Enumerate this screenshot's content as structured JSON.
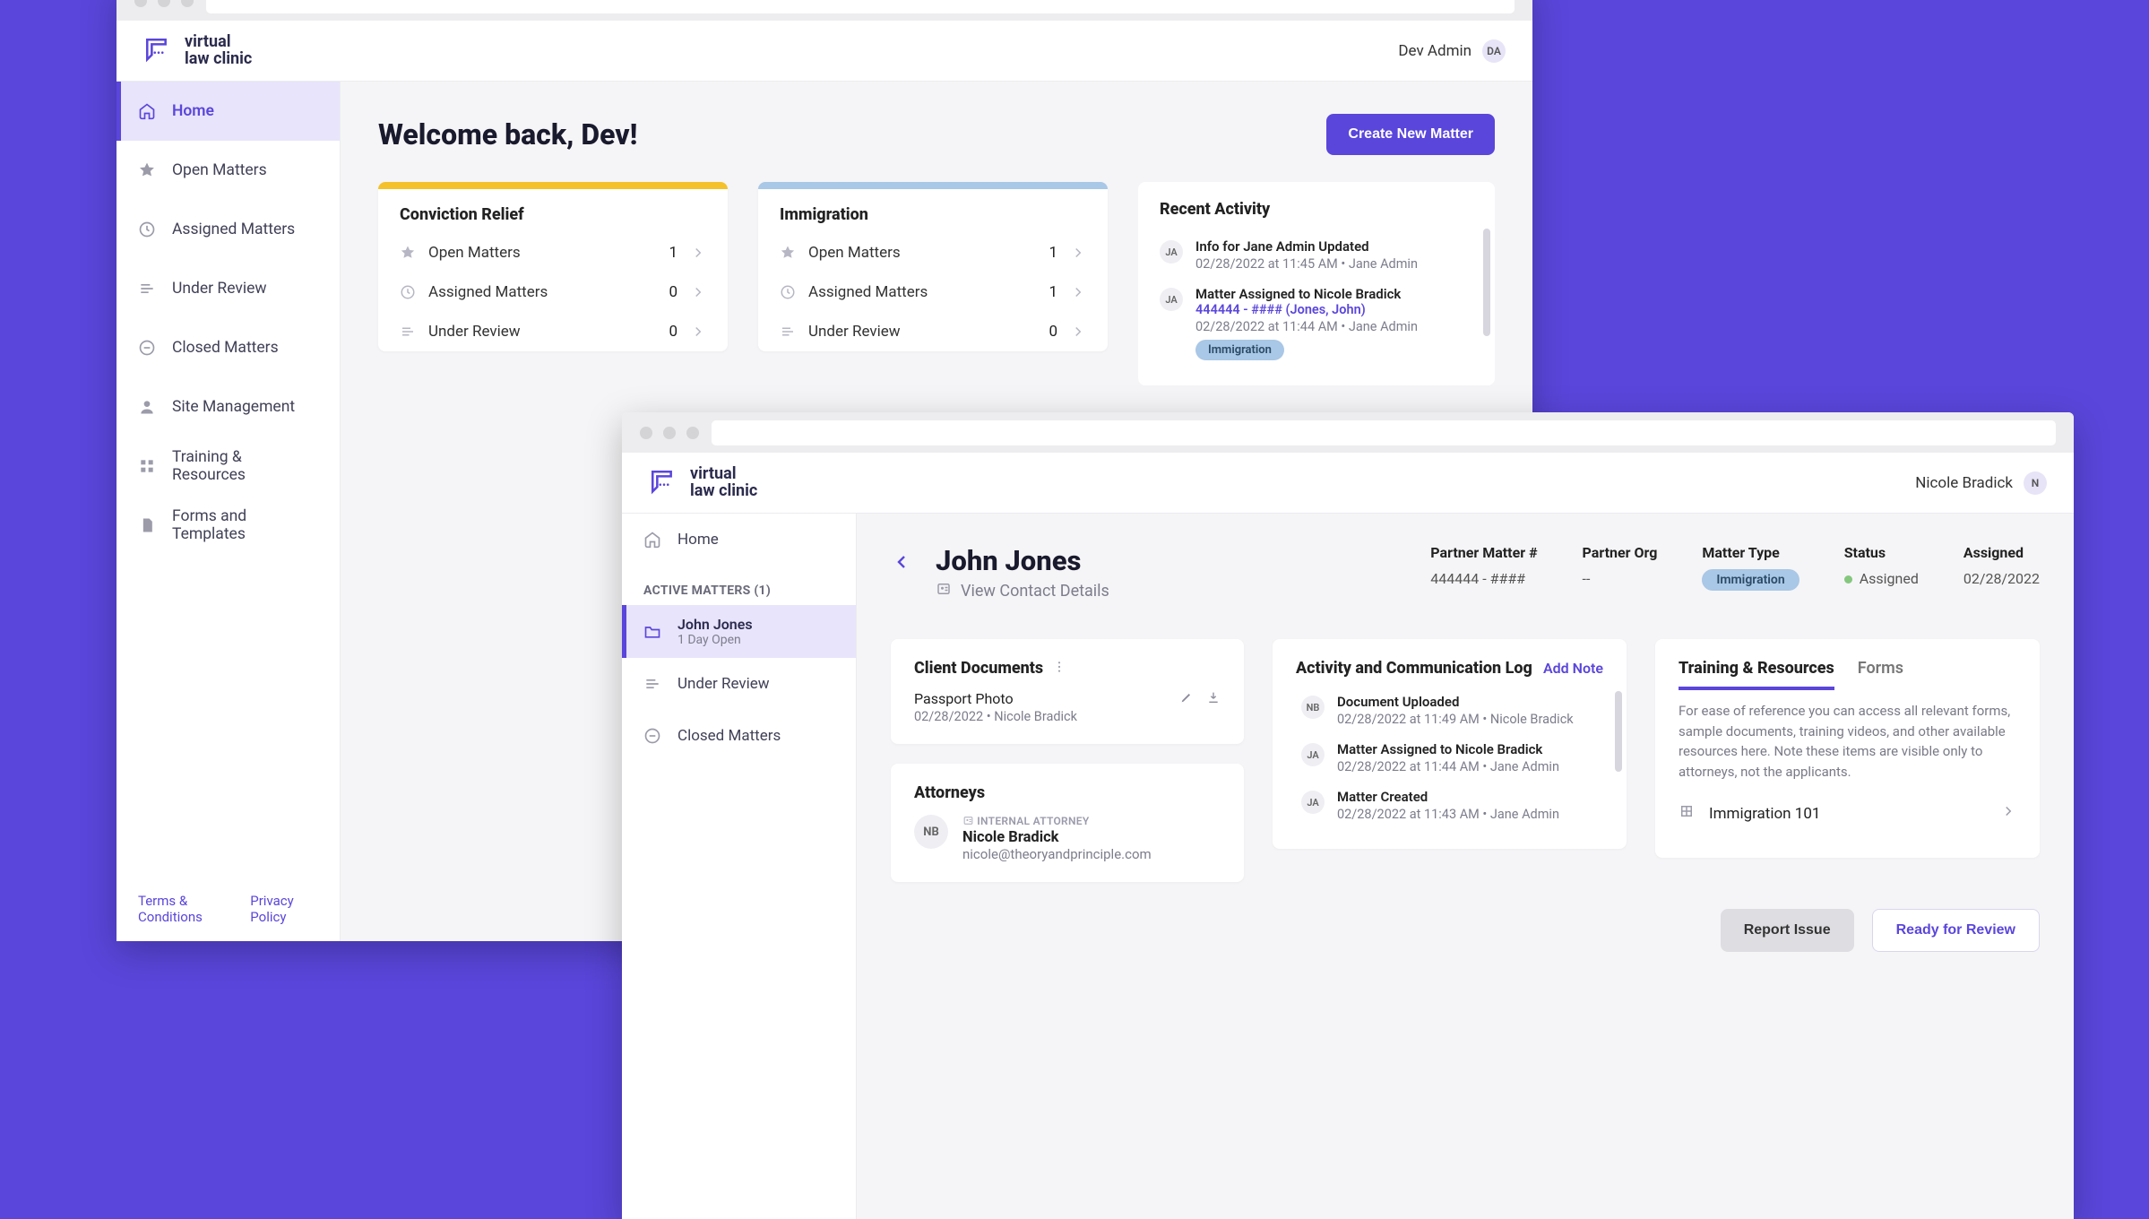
{
  "brand": "virtual law clinic",
  "windowA": {
    "user": {
      "name": "Dev Admin",
      "initials": "DA"
    },
    "sidebar": [
      {
        "label": "Home",
        "icon": "home",
        "active": true
      },
      {
        "label": "Open Matters",
        "icon": "star"
      },
      {
        "label": "Assigned Matters",
        "icon": "clock"
      },
      {
        "label": "Under Review",
        "icon": "review"
      },
      {
        "label": "Closed Matters",
        "icon": "closed"
      },
      {
        "label": "Site Management",
        "icon": "person"
      },
      {
        "label": "Training & Resources",
        "icon": "grid"
      },
      {
        "label": "Forms and Templates",
        "icon": "doc"
      }
    ],
    "footerLinks": {
      "terms": "Terms & Conditions",
      "privacy": "Privacy Policy"
    },
    "welcome": "Welcome back, Dev!",
    "cta": "Create New Matter",
    "cards": [
      {
        "title": "Conviction Relief",
        "color": "yellow",
        "rows": [
          {
            "icon": "star",
            "label": "Open Matters",
            "n": 1
          },
          {
            "icon": "clock",
            "label": "Assigned Matters",
            "n": 0
          },
          {
            "icon": "review",
            "label": "Under Review",
            "n": 0
          }
        ]
      },
      {
        "title": "Immigration",
        "color": "blue",
        "rows": [
          {
            "icon": "star",
            "label": "Open Matters",
            "n": 1
          },
          {
            "icon": "clock",
            "label": "Assigned Matters",
            "n": 1
          },
          {
            "icon": "review",
            "label": "Under Review",
            "n": 0
          }
        ]
      }
    ],
    "recent": {
      "title": "Recent Activity",
      "items": [
        {
          "initials": "JA",
          "title": "Info for Jane Admin Updated",
          "meta": "02/28/2022 at 11:45 AM • Jane Admin"
        },
        {
          "initials": "JA",
          "title": "Matter Assigned to Nicole Bradick",
          "link": "444444 - #### (Jones, John)",
          "meta": "02/28/2022 at 11:44 AM • Jane Admin",
          "badge": "Immigration"
        }
      ]
    }
  },
  "windowB": {
    "user": {
      "name": "Nicole Bradick",
      "initials": "N"
    },
    "sidebar": {
      "home": "Home",
      "sectionLabel": "ACTIVE MATTERS (1)",
      "matter": {
        "name": "John Jones",
        "sub": "1 Day Open"
      },
      "underReview": "Under Review",
      "closed": "Closed Matters"
    },
    "header": {
      "client": "John Jones",
      "viewContact": "View Contact Details",
      "cols": [
        {
          "label": "Partner Matter #",
          "value": "444444 - ####"
        },
        {
          "label": "Partner Org",
          "value": "--"
        },
        {
          "label": "Matter Type",
          "pill": "Immigration"
        },
        {
          "label": "Status",
          "status": "Assigned"
        },
        {
          "label": "Assigned",
          "value": "02/28/2022"
        }
      ]
    },
    "clientDocs": {
      "title": "Client Documents",
      "doc": {
        "title": "Passport Photo",
        "meta": "02/28/2022 • Nicole Bradick"
      }
    },
    "attorneys": {
      "title": "Attorneys",
      "att": {
        "initials": "NB",
        "tag": "INTERNAL ATTORNEY",
        "name": "Nicole Bradick",
        "email": "nicole@theoryandprinciple.com"
      }
    },
    "activity": {
      "title": "Activity and Communication Log",
      "addNote": "Add Note",
      "items": [
        {
          "initials": "NB",
          "title": "Document Uploaded",
          "meta": "02/28/2022 at 11:49 AM • Nicole Bradick"
        },
        {
          "initials": "JA",
          "title": "Matter Assigned to Nicole Bradick",
          "meta": "02/28/2022 at 11:44 AM • Jane Admin"
        },
        {
          "initials": "JA",
          "title": "Matter Created",
          "meta": "02/28/2022 at 11:43 AM • Jane Admin"
        }
      ]
    },
    "resources": {
      "tabs": {
        "a": "Training & Resources",
        "b": "Forms"
      },
      "para": "For ease of reference you can access all relevant forms, sample documents, training videos, and other available resources here. Note these items are visible only to attorneys, not the applicants.",
      "row": "Immigration 101"
    },
    "footer": {
      "report": "Report Issue",
      "ready": "Ready for Review"
    }
  }
}
